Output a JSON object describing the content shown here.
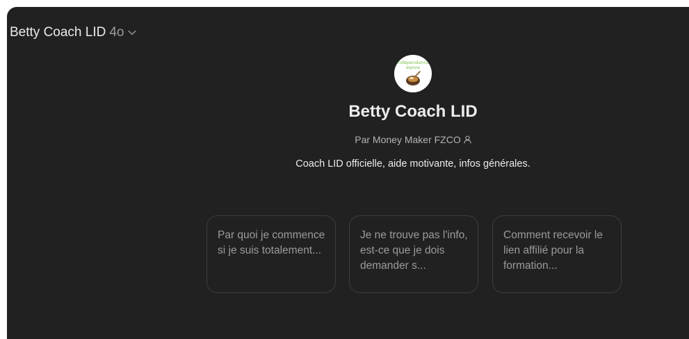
{
  "header": {
    "gpt_name": "Betty Coach LID",
    "model": "4o"
  },
  "gpt": {
    "avatar_text_line1": "indépendance",
    "avatar_text_line2": "digitale",
    "title": "Betty Coach LID",
    "author": "Par Money Maker FZCO",
    "description": "Coach LID officielle, aide motivante, infos générales."
  },
  "starters": [
    {
      "text": "Par quoi je commence si je suis totalement..."
    },
    {
      "text": "Je ne trouve pas l'info, est-ce que je dois demander s..."
    },
    {
      "text": "Comment recevoir le lien affilié pour la formation..."
    }
  ],
  "colors": {
    "background": "#212121",
    "card_border": "#3d3d3d",
    "text_primary": "#ececec",
    "text_secondary": "#9b9b9b"
  },
  "icons": {
    "model_dropdown": "chevron-down-icon",
    "author": "person-icon"
  }
}
